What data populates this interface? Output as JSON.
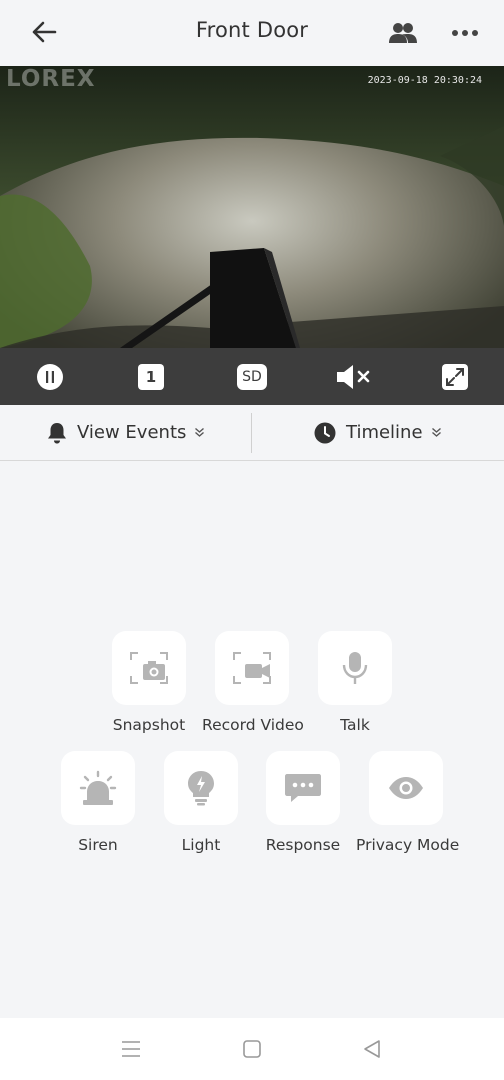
{
  "header": {
    "title": "Front Door",
    "icons": {
      "back": "arrow-left-icon",
      "people": "people-icon",
      "more": "more-icon"
    }
  },
  "video": {
    "watermark": "LOREX",
    "timestamp": "2023-09-18 20:30:24"
  },
  "controls": {
    "icons": [
      "pause-icon",
      "channel-icon",
      "sd-quality-icon",
      "mute-icon",
      "fullscreen-icon"
    ],
    "channel_label": "1",
    "quality_label": "SD"
  },
  "tabs": {
    "events_label": "View Events",
    "timeline_label": "Timeline"
  },
  "actions": [
    {
      "label": "Snapshot",
      "icon": "snapshot-icon"
    },
    {
      "label": "Record Video",
      "icon": "record-video-icon"
    },
    {
      "label": "Talk",
      "icon": "microphone-icon"
    },
    {
      "label": "Siren",
      "icon": "siren-icon"
    },
    {
      "label": "Light",
      "icon": "light-bulb-icon"
    },
    {
      "label": "Response",
      "icon": "chat-bubble-icon"
    },
    {
      "label": "Privacy Mode",
      "icon": "eye-icon"
    }
  ],
  "navbar": {
    "icons": [
      "menu-icon",
      "home-square-icon",
      "back-triangle-icon"
    ]
  },
  "colors": {
    "accent": "#333333",
    "icon_gray": "#b5b5b5",
    "control_bar": "#3d3d3d",
    "background": "#f4f5f7"
  }
}
